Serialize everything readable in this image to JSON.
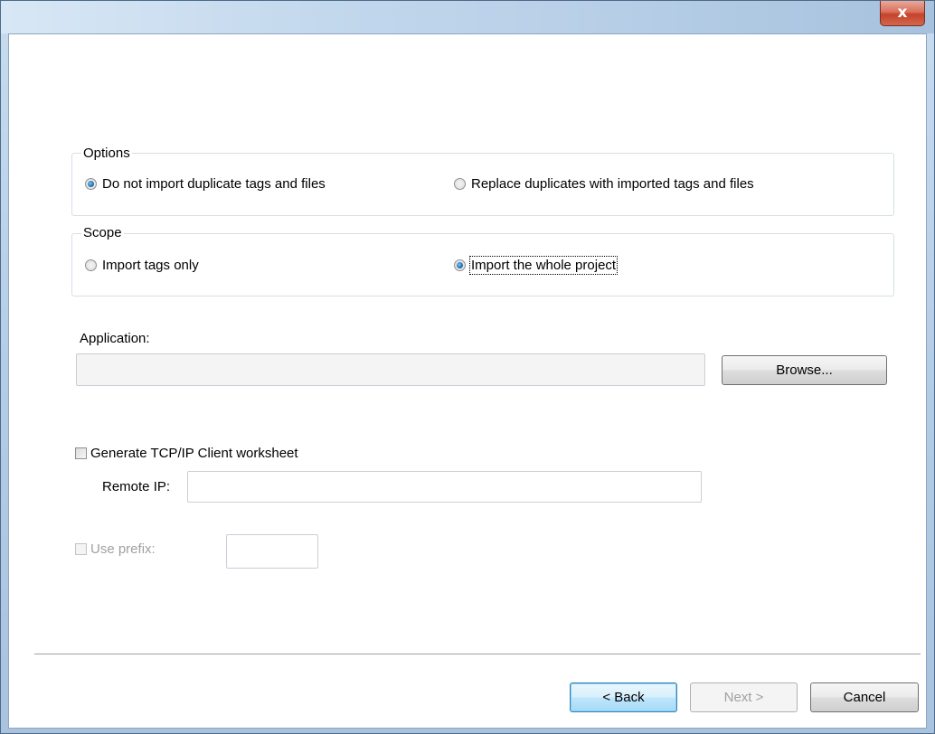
{
  "window": {
    "close_glyph": "x"
  },
  "options": {
    "label": "Options",
    "choices": [
      {
        "label": "Do not import duplicate tags and files",
        "checked": true
      },
      {
        "label": "Replace duplicates with imported tags and files",
        "checked": false
      }
    ]
  },
  "scope": {
    "label": "Scope",
    "choices": [
      {
        "label": "Import tags only",
        "checked": false
      },
      {
        "label": "Import the whole project",
        "checked": true
      }
    ]
  },
  "application": {
    "label": "Application:",
    "value": "",
    "browse_label": "Browse..."
  },
  "tcp": {
    "label": "Generate TCP/IP Client worksheet",
    "checked": false,
    "remote_ip_label": "Remote IP:",
    "remote_ip_value": ""
  },
  "prefix": {
    "label": "Use prefix:",
    "checked": false,
    "value": ""
  },
  "footer": {
    "back_label": "< Back",
    "next_label": "Next >",
    "cancel_label": "Cancel"
  }
}
